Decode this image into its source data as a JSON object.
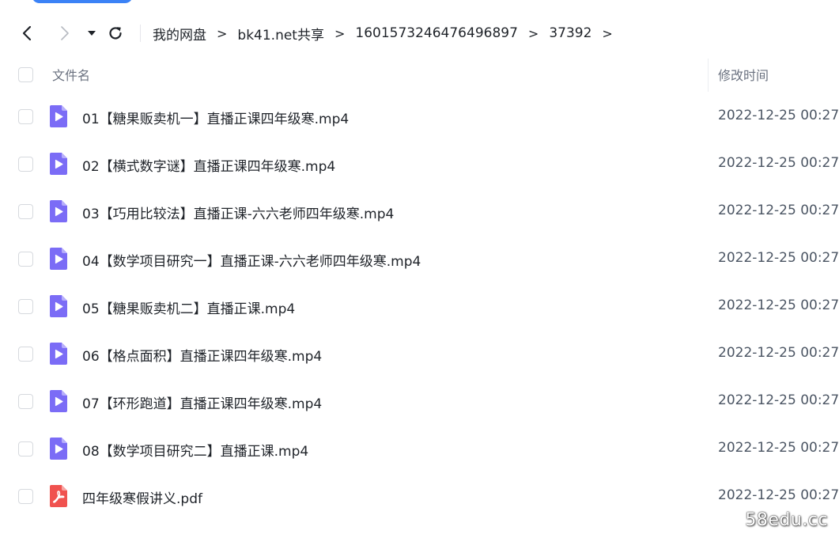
{
  "navigation": {
    "back_icon": "chevron-left-icon",
    "forward_icon": "chevron-right-icon",
    "dropdown_icon": "caret-down-icon",
    "refresh_icon": "refresh-icon",
    "breadcrumb": [
      "我的网盘",
      "bk41.net共享",
      "1601573246476496897",
      "37392"
    ],
    "separator": ">"
  },
  "table": {
    "header": {
      "name": "文件名",
      "modified": "修改时间"
    },
    "rows": [
      {
        "name": "01【糖果贩卖机一】直播正课四年级寒.mp4",
        "modified": "2022-12-25 00:27",
        "type": "video"
      },
      {
        "name": "02【横式数字谜】直播正课四年级寒.mp4",
        "modified": "2022-12-25 00:27",
        "type": "video"
      },
      {
        "name": "03【巧用比较法】直播正课-六六老师四年级寒.mp4",
        "modified": "2022-12-25 00:27",
        "type": "video"
      },
      {
        "name": "04【数学项目研究一】直播正课-六六老师四年级寒.mp4",
        "modified": "2022-12-25 00:27",
        "type": "video"
      },
      {
        "name": "05【糖果贩卖机二】直播正课.mp4",
        "modified": "2022-12-25 00:27",
        "type": "video"
      },
      {
        "name": "06【格点面积】直播正课四年级寒.mp4",
        "modified": "2022-12-25 00:27",
        "type": "video"
      },
      {
        "name": "07【环形跑道】直播正课四年级寒.mp4",
        "modified": "2022-12-25 00:27",
        "type": "video"
      },
      {
        "name": "08【数学项目研究二】直播正课.mp4",
        "modified": "2022-12-25 00:27",
        "type": "video"
      },
      {
        "name": "四年级寒假讲义.pdf",
        "modified": "2022-12-25 00:27",
        "type": "pdf"
      }
    ]
  },
  "colors": {
    "video_icon": "#7b6cf6",
    "pdf_icon": "#f0524f",
    "accent": "#3b82f6"
  },
  "watermark": "58edu.cc"
}
